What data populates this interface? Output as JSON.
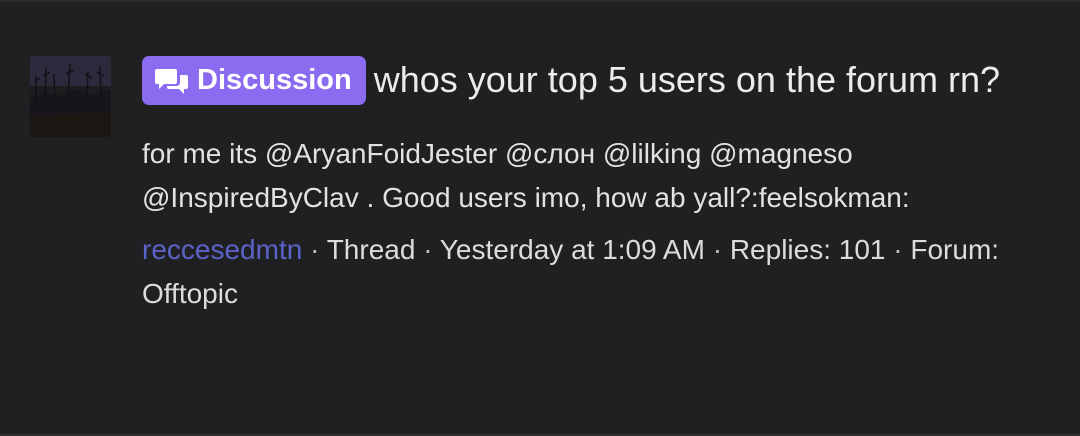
{
  "thread": {
    "prefix_label": "Discussion",
    "prefix_icon": "chat-bubbles-icon",
    "title": "whos your top 5 users on the forum rn?",
    "snippet": "for me its @AryanFoidJester @слон @lilking @magneso @InspiredByClav . Good users imo, how ab yall?:feelsokman:",
    "author": "reccesedmtn",
    "type": "Thread",
    "posted": "Yesterday at 1:09 AM",
    "replies": "Replies: 101",
    "forum": "Forum: Offtopic",
    "separator": "·"
  },
  "colors": {
    "background": "#202022",
    "badge": "#8b6cf0",
    "author_link": "#5b63c9",
    "text": "#ececec"
  }
}
